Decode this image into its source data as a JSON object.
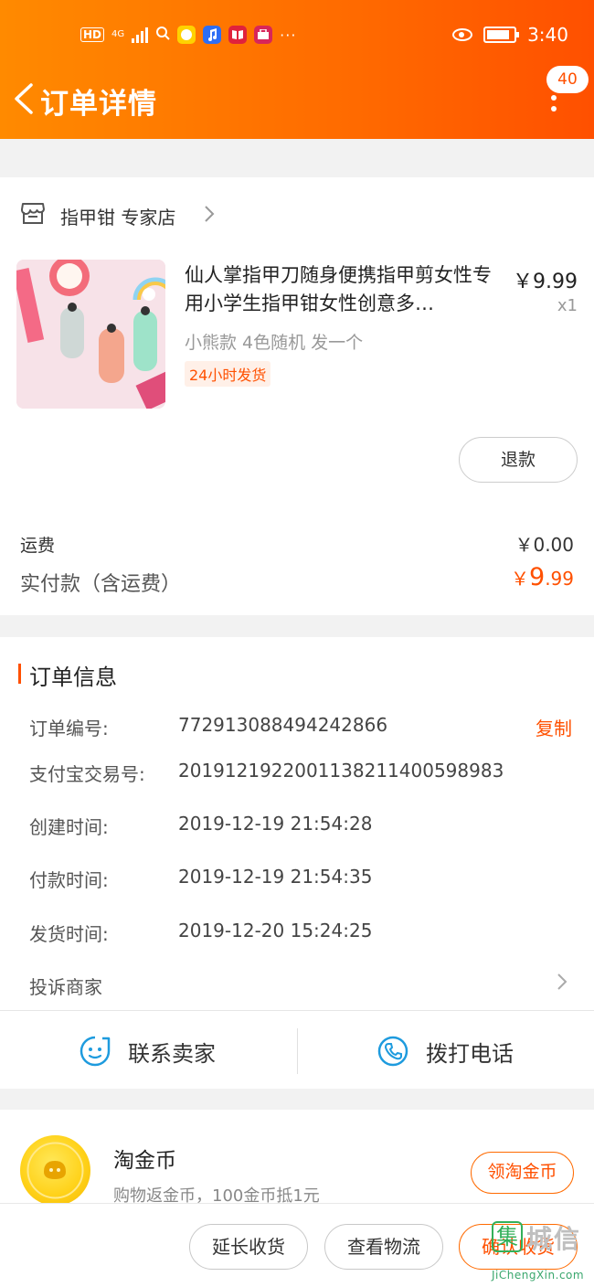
{
  "status_bar": {
    "hd": "HD",
    "network": "4G",
    "more": "···",
    "time": "3:40"
  },
  "header": {
    "title": "订单详情",
    "badge_count": "40"
  },
  "shop": {
    "name": "指甲钳 专家店"
  },
  "product": {
    "title": "仙人掌指甲刀随身便携指甲剪女性专用小学生指甲钳女性创意多…",
    "price": "￥9.99",
    "quantity": "x1",
    "sku": "小熊款 4色随机 发一个",
    "ship_tag": "24小时发货",
    "refund_label": "退款"
  },
  "payment": {
    "shipping_label": "运费",
    "shipping_value": "￥0.00",
    "paid_label": "实付款（含运费）",
    "paid_currency": "￥",
    "paid_integer": "9",
    "paid_decimal": ".99"
  },
  "order_info": {
    "title": "订单信息",
    "rows": [
      {
        "label": "订单编号:",
        "value": "772913088494242866"
      },
      {
        "label": "支付宝交易号:",
        "value": "2019121922001138211400598983"
      },
      {
        "label": "创建时间:",
        "value": "2019-12-19 21:54:28"
      },
      {
        "label": "付款时间:",
        "value": "2019-12-19 21:54:35"
      },
      {
        "label": "发货时间:",
        "value": "2019-12-20 15:24:25"
      }
    ],
    "copy_label": "复制",
    "complain_label": "投诉商家",
    "contact_seller": "联系卖家",
    "call_phone": "拨打电话"
  },
  "coins": {
    "title": "淘金币",
    "subtitle": "购物返金币，100金币抵1元",
    "button": "领淘金币"
  },
  "bottom_bar": {
    "extend": "延长收货",
    "logistics": "查看物流",
    "confirm": "确认收货"
  },
  "watermark": {
    "text": "城信",
    "url": "JiChengXin.com"
  },
  "colors": {
    "accent": "#ff5000",
    "header_start": "#ff8a00",
    "header_end": "#ff5000",
    "link_blue": "#1e9bde"
  }
}
